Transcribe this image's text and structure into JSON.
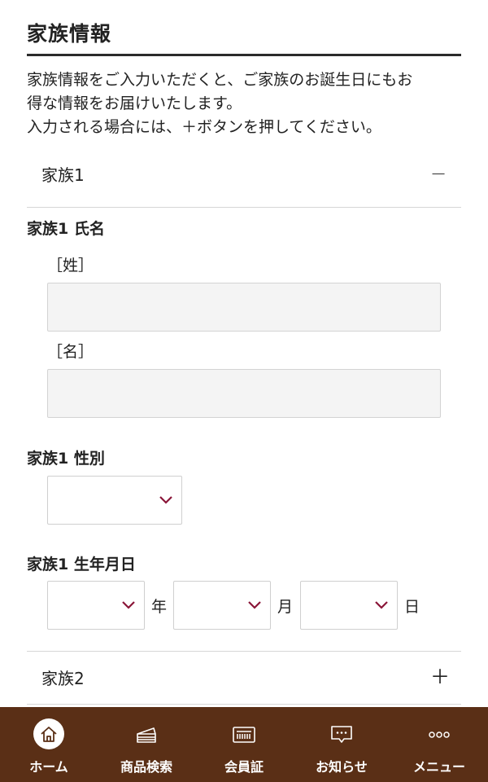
{
  "page": {
    "title": "家族情報"
  },
  "intro": {
    "line1": "家族情報をご入力いただくと、ご家族のお誕生日にもお",
    "line2": "得な情報をお届けいたします。",
    "line3": "入力される場合には、＋ボタンを押してください。"
  },
  "family1": {
    "header": "家族1",
    "toggle": "−",
    "name_label": "家族1 氏名",
    "last_name_label": "［姓］",
    "last_name_value": "",
    "first_name_label": "［名］",
    "first_name_value": "",
    "gender_label": "家族1 性別",
    "gender_value": "",
    "birthday_label": "家族1 生年月日",
    "year_value": "",
    "month_value": "",
    "day_value": "",
    "year_unit": "年",
    "month_unit": "月",
    "day_unit": "日"
  },
  "family2": {
    "header": "家族2",
    "toggle": "＋"
  },
  "nav": {
    "items": [
      {
        "label": "ホーム",
        "icon": "home-icon"
      },
      {
        "label": "商品検索",
        "icon": "cake-icon"
      },
      {
        "label": "会員証",
        "icon": "barcode-card-icon"
      },
      {
        "label": "お知らせ",
        "icon": "message-icon"
      },
      {
        "label": "メニュー",
        "icon": "more-icon"
      }
    ]
  },
  "colors": {
    "nav_bg": "#5a2f16",
    "accent": "#8a1538",
    "input_bg": "#f4f4f4"
  }
}
